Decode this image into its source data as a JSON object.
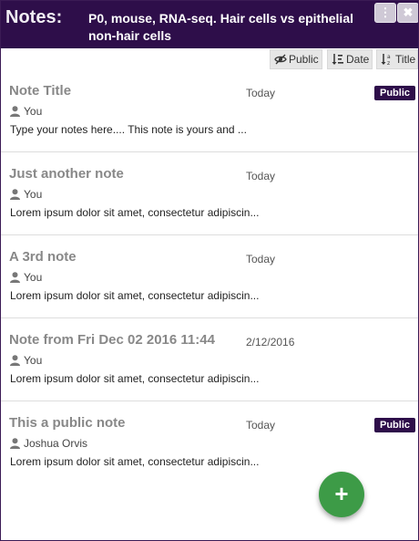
{
  "header": {
    "label": "Notes:",
    "title": "P0, mouse, RNA-seq. Hair cells vs epithelial non-hair cells",
    "menu_icon": "vertical-dots-icon",
    "close_icon": "close-icon"
  },
  "toolbar": {
    "public_label": "Public",
    "date_label": "Date",
    "title_label": "Title"
  },
  "notes": [
    {
      "title": "Note Title",
      "date": "Today",
      "badge": "Public",
      "author": "You",
      "body": "Type your notes here.... This note is yours and ..."
    },
    {
      "title": "Just another note",
      "date": "Today",
      "badge": "",
      "author": "You",
      "body": "Lorem ipsum dolor sit amet, consectetur adipiscin..."
    },
    {
      "title": "A 3rd note",
      "date": "Today",
      "badge": "",
      "author": "You",
      "body": "Lorem ipsum dolor sit amet, consectetur adipiscin..."
    },
    {
      "title": "Note from Fri Dec 02 2016 11:44",
      "date": "2/12/2016",
      "badge": "",
      "author": "You",
      "body": "Lorem ipsum dolor sit amet, consectetur adipiscin..."
    },
    {
      "title": "This a public note",
      "date": "Today",
      "badge": "Public",
      "author": "Joshua Orvis",
      "body": "Lorem ipsum dolor sit amet, consectetur adipiscin..."
    }
  ],
  "fab": {
    "label": "+"
  },
  "colors": {
    "header_bg": "#2e0e4a",
    "badge_bg": "#2e0e4a",
    "fab_bg": "#3d9b47"
  }
}
